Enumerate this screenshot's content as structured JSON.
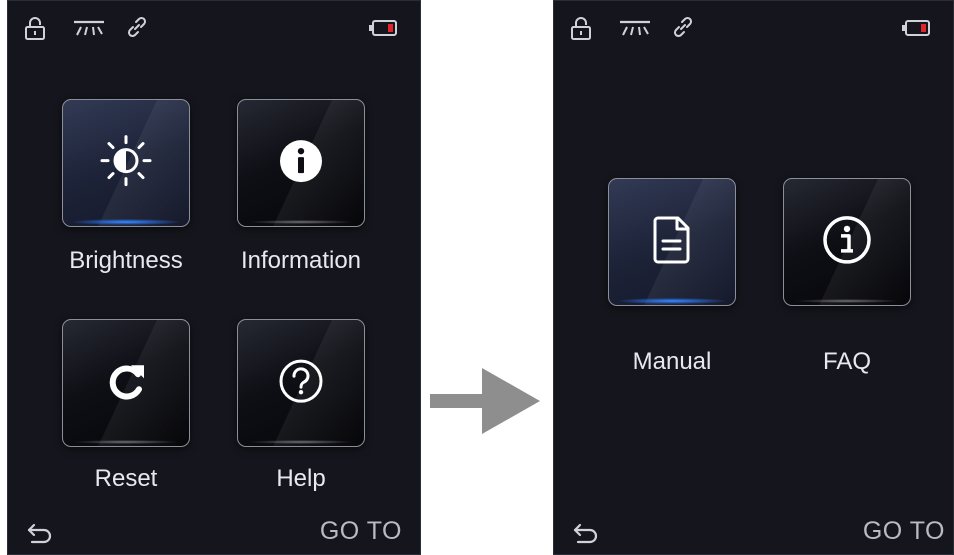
{
  "screens": [
    {
      "tiles": [
        {
          "label": "Brightness",
          "icon": "brightness-icon",
          "selected": true
        },
        {
          "label": "Information",
          "icon": "info-icon",
          "selected": false
        },
        {
          "label": "Reset",
          "icon": "reset-icon",
          "selected": false
        },
        {
          "label": "Help",
          "icon": "help-icon",
          "selected": false
        }
      ],
      "footer": {
        "goto_label": "GO TO"
      }
    },
    {
      "tiles": [
        {
          "label": "Manual",
          "icon": "document-icon",
          "selected": true
        },
        {
          "label": "FAQ",
          "icon": "faq-info-icon",
          "selected": false
        }
      ],
      "footer": {
        "goto_label": "GO TO"
      }
    }
  ],
  "status_icons": [
    "lock-icon",
    "brightness-status-icon",
    "link-icon",
    "battery-icon"
  ],
  "colors": {
    "background": "#15161d",
    "selected_glow": "#3c8cff",
    "battery_low": "#e0262a",
    "text": "#e8e9ee",
    "arrow": "#8e8e8e"
  }
}
